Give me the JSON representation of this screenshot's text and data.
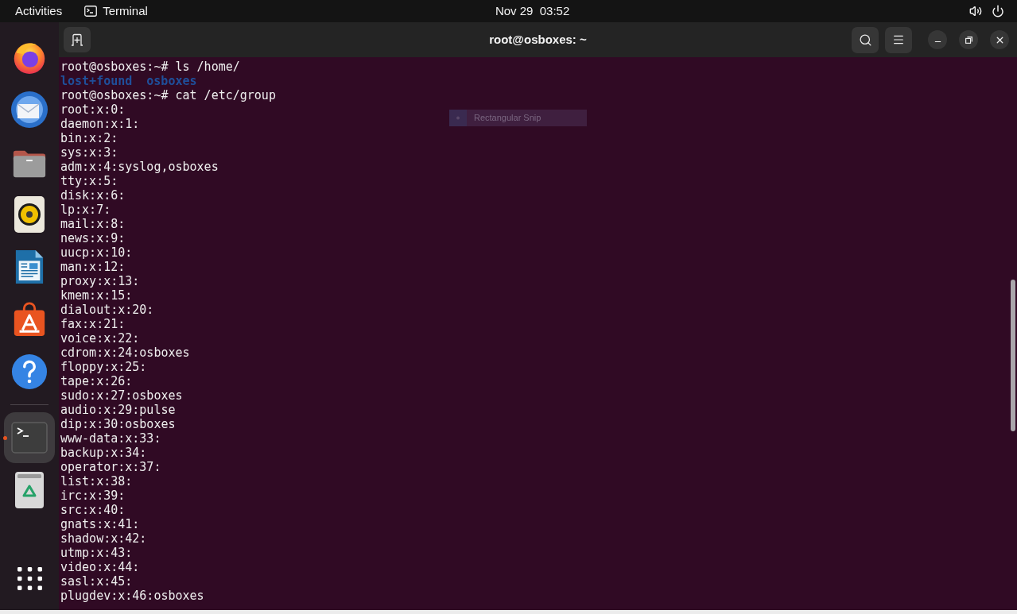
{
  "top_bar": {
    "activities": "Activities",
    "app_menu": "Terminal",
    "clock": "Nov 29  03:52"
  },
  "dock": {
    "favorites": [
      {
        "kind": "browser",
        "selected": false,
        "running": false
      },
      {
        "kind": "mail",
        "selected": false,
        "running": false
      },
      {
        "kind": "files",
        "selected": false,
        "running": false
      },
      {
        "kind": "music",
        "selected": false,
        "running": false
      },
      {
        "kind": "writer",
        "selected": false,
        "running": false
      },
      {
        "kind": "store",
        "selected": false,
        "running": false
      },
      {
        "kind": "help",
        "selected": false,
        "running": false
      }
    ],
    "others": [
      {
        "kind": "terminal",
        "selected": true,
        "running": true
      },
      {
        "kind": "trash",
        "selected": false,
        "running": false
      }
    ]
  },
  "terminal": {
    "title": "root@osboxes: ~",
    "lines": [
      {
        "kind": "text",
        "text": "root@osboxes:~# ls /home/"
      },
      {
        "kind": "listing",
        "entries": [
          "lost+found",
          "osboxes"
        ]
      },
      {
        "kind": "text",
        "text": "root@osboxes:~# cat /etc/group"
      },
      {
        "kind": "text",
        "text": "root:x:0:"
      },
      {
        "kind": "text",
        "text": "daemon:x:1:"
      },
      {
        "kind": "text",
        "text": "bin:x:2:"
      },
      {
        "kind": "text",
        "text": "sys:x:3:"
      },
      {
        "kind": "text",
        "text": "adm:x:4:syslog,osboxes"
      },
      {
        "kind": "text",
        "text": "tty:x:5:"
      },
      {
        "kind": "text",
        "text": "disk:x:6:"
      },
      {
        "kind": "text",
        "text": "lp:x:7:"
      },
      {
        "kind": "text",
        "text": "mail:x:8:"
      },
      {
        "kind": "text",
        "text": "news:x:9:"
      },
      {
        "kind": "text",
        "text": "uucp:x:10:"
      },
      {
        "kind": "text",
        "text": "man:x:12:"
      },
      {
        "kind": "text",
        "text": "proxy:x:13:"
      },
      {
        "kind": "text",
        "text": "kmem:x:15:"
      },
      {
        "kind": "text",
        "text": "dialout:x:20:"
      },
      {
        "kind": "text",
        "text": "fax:x:21:"
      },
      {
        "kind": "text",
        "text": "voice:x:22:"
      },
      {
        "kind": "text",
        "text": "cdrom:x:24:osboxes"
      },
      {
        "kind": "text",
        "text": "floppy:x:25:"
      },
      {
        "kind": "text",
        "text": "tape:x:26:"
      },
      {
        "kind": "text",
        "text": "sudo:x:27:osboxes"
      },
      {
        "kind": "text",
        "text": "audio:x:29:pulse"
      },
      {
        "kind": "text",
        "text": "dip:x:30:osboxes"
      },
      {
        "kind": "text",
        "text": "www-data:x:33:"
      },
      {
        "kind": "text",
        "text": "backup:x:34:"
      },
      {
        "kind": "text",
        "text": "operator:x:37:"
      },
      {
        "kind": "text",
        "text": "list:x:38:"
      },
      {
        "kind": "text",
        "text": "irc:x:39:"
      },
      {
        "kind": "text",
        "text": "src:x:40:"
      },
      {
        "kind": "text",
        "text": "gnats:x:41:"
      },
      {
        "kind": "text",
        "text": "shadow:x:42:"
      },
      {
        "kind": "text",
        "text": "utmp:x:43:"
      },
      {
        "kind": "text",
        "text": "video:x:44:"
      },
      {
        "kind": "text",
        "text": "sasl:x:45:"
      },
      {
        "kind": "text",
        "text": "plugdev:x:46:osboxes"
      }
    ]
  },
  "snip_overlay": {
    "label": "Rectangular Snip"
  }
}
